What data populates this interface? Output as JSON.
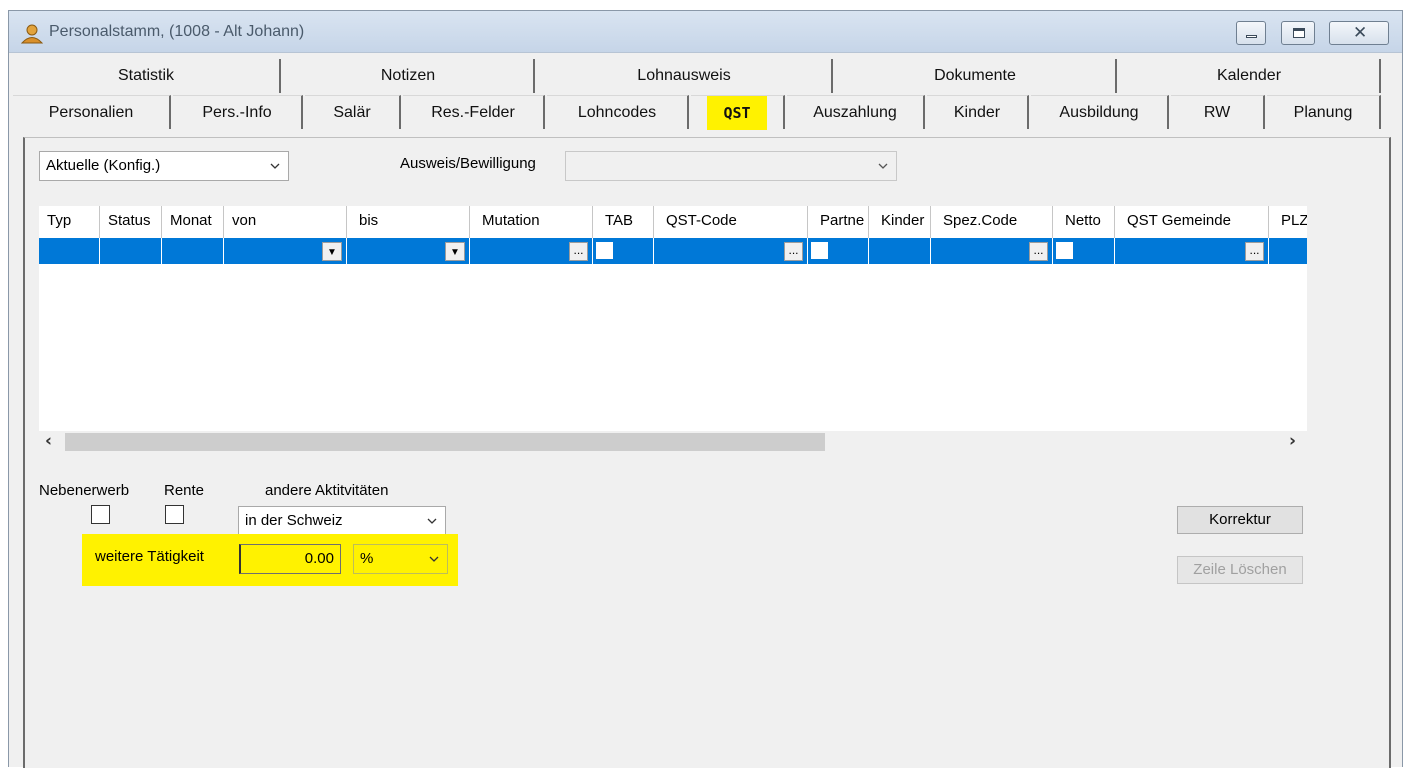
{
  "window": {
    "title": "Personalstamm, (1008 - Alt Johann)",
    "close_glyph": "✕"
  },
  "tabs_row1": [
    "Statistik",
    "Notizen",
    "Lohnausweis",
    "Dokumente",
    "Kalender"
  ],
  "tabs_row2": [
    "Personalien",
    "Pers.-Info",
    "Salär",
    "Res.-Felder",
    "Lohncodes",
    "QST",
    "Auszahlung",
    "Kinder",
    "Ausbildung",
    "RW",
    "Planung"
  ],
  "active_tab": "QST",
  "filter": {
    "selected": "Aktuelle (Konfig.)",
    "ausweis_label": "Ausweis/Bewilligung",
    "ausweis_value": ""
  },
  "grid": {
    "columns": [
      "Typ",
      "Status",
      "Monat",
      "von",
      "bis",
      "Mutation",
      "TAB",
      "QST-Code",
      "Partne",
      "Kinder",
      "Spez.Code",
      "Netto",
      "QST Gemeinde",
      "PLZ"
    ],
    "ellipsis": "...",
    "dropdown_glyph": "▼",
    "scroll_left": "‹",
    "scroll_right": "›"
  },
  "options": {
    "nebenerwerb_label": "Nebenerwerb",
    "rente_label": "Rente",
    "andere_label": "andere Aktitvitäten",
    "andere_value": "in der Schweiz",
    "weitere_label": "weitere Tätigkeit",
    "weitere_value": "0.00",
    "unit_value": "%"
  },
  "buttons": {
    "korrektur": "Korrektur",
    "zeile_loeschen": "Zeile Löschen"
  },
  "colors": {
    "highlight": "#fff200",
    "selection": "#0078d7"
  }
}
